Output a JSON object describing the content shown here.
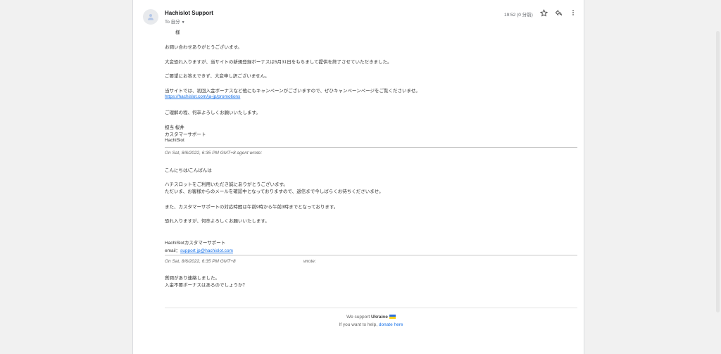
{
  "header": {
    "sender": "Hachislot Support",
    "to_label": "To 自分",
    "time": "19:52 (0 分前)"
  },
  "icons": {
    "avatar": "person-icon",
    "star": "star-icon",
    "reply": "reply-icon",
    "more": "more-vert-icon"
  },
  "message": {
    "salutation": "様",
    "lines": [
      "お問い合わせありがとうございます。",
      "大変恐れ入りますが、当サイトの新規登録ボーナスは5月31日をもちまして提供を終了させていただきました。",
      "ご要望にお答えできず、大変申し訳ございません。",
      "当サイトでは、初回入金ボーナスなど他にもキャンペーンがございますので、ぜひキャンペーンページをご覧くださいませ。"
    ],
    "promo_link": "https://hachislot.com/ja-jp/promotions",
    "closing": "ご理解の程、何卒よろしくお願いいたします。",
    "signature": [
      "担当 桜井",
      "カスタマーサポート",
      "HachiSlot"
    ]
  },
  "quote1": {
    "header": "On Sat, 8/6/2022, 6:35 PM GMT+8 agent wrote:",
    "greeting": "こんにちは/こんばんは",
    "lines": [
      "ハチスロットをご利用いただき誠にありがとうございます。",
      "ただいま、お客様からのメールを確認中となっておりますので、返信まで今しばらくお待ちくださいませ。",
      "また、カスタマーサポートの対応時間は午前9時から午前3時までとなっております。",
      "恐れ入りますが、何卒よろしくお願いいたします。"
    ],
    "sig_name": "HachiSlotカスタマーサポート",
    "email_label": "email：",
    "email": "support jp@hachislot.com"
  },
  "quote2": {
    "header_left": "On Sat, 8/6/2022, 6:35 PM GMT+8",
    "header_right": "wrote:",
    "lines": [
      "質問があり連絡しました。",
      "入金不要ボーナスはあるのでしょうか？"
    ]
  },
  "footer": {
    "support_text": "We support",
    "country": "Ukraine",
    "help_text": "If you want to help,",
    "donate_link": "donate here"
  }
}
